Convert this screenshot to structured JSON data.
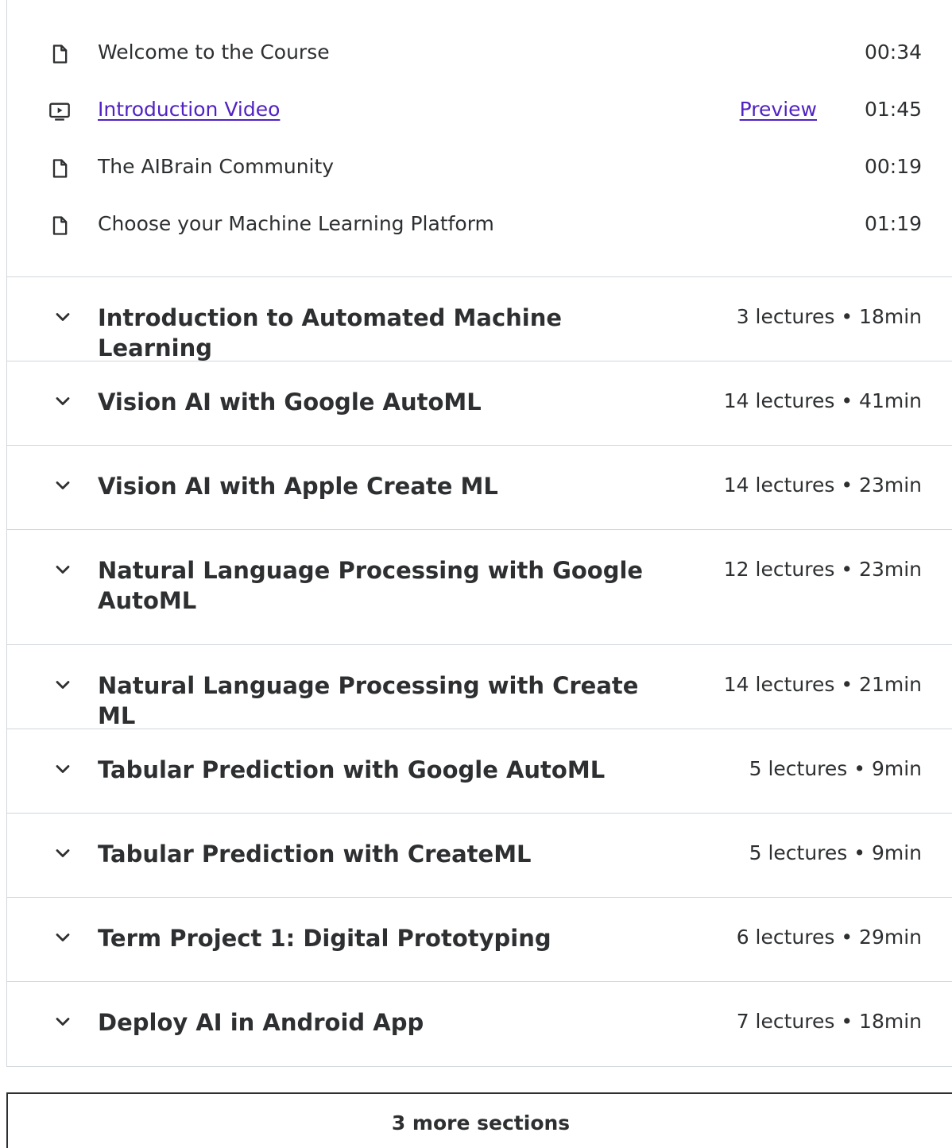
{
  "lectures": [
    {
      "title": "Welcome to the Course",
      "duration": "00:34",
      "icon": "file-icon",
      "link": false
    },
    {
      "title": "Introduction Video",
      "duration": "01:45",
      "icon": "video-icon",
      "link": true,
      "preview_label": "Preview"
    },
    {
      "title": "The AIBrain Community",
      "duration": "00:19",
      "icon": "file-icon",
      "link": false
    },
    {
      "title": "Choose your Machine Learning Platform",
      "duration": "01:19",
      "icon": "file-icon",
      "link": false
    }
  ],
  "sections": [
    {
      "title": "Introduction to Automated Machine Learning",
      "meta": "3 lectures • 18min"
    },
    {
      "title": "Vision AI with Google AutoML",
      "meta": "14 lectures • 41min"
    },
    {
      "title": "Vision AI with Apple Create ML",
      "meta": "14 lectures • 23min"
    },
    {
      "title": "Natural Language Processing with Google AutoML",
      "meta": "12 lectures • 23min"
    },
    {
      "title": "Natural Language Processing with Create ML",
      "meta": "14 lectures • 21min"
    },
    {
      "title": "Tabular Prediction with Google AutoML",
      "meta": "5 lectures • 9min"
    },
    {
      "title": "Tabular Prediction with CreateML",
      "meta": "5 lectures • 9min"
    },
    {
      "title": "Term Project 1: Digital Prototyping",
      "meta": "6 lectures • 29min"
    },
    {
      "title": "Deploy AI in Android App",
      "meta": "7 lectures • 18min"
    }
  ],
  "more_sections_label": "3 more sections",
  "colors": {
    "text": "#2d2f31",
    "link": "#5022c3",
    "border": "#d1d7dc"
  }
}
